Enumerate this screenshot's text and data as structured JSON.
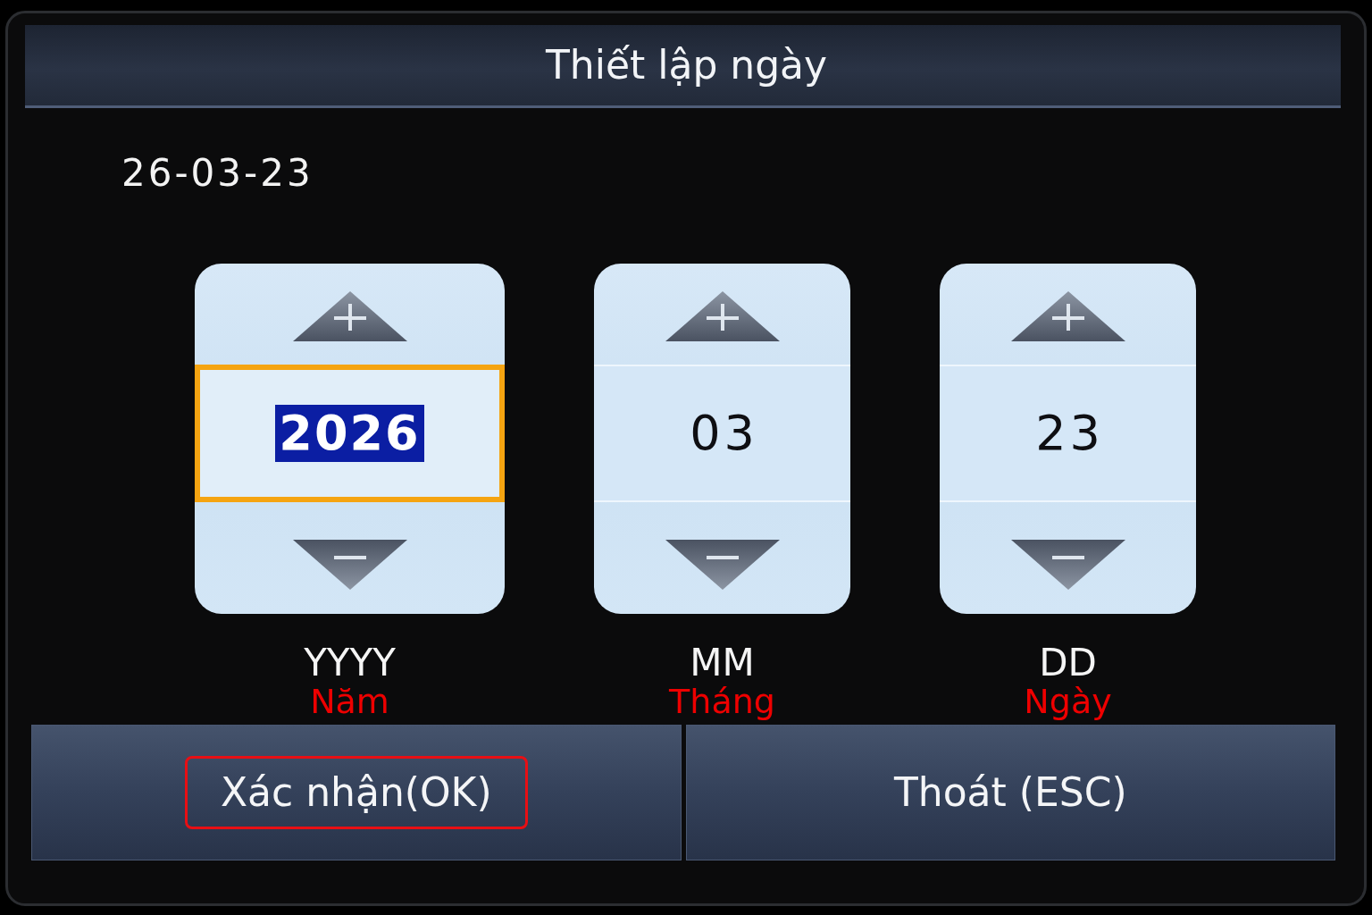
{
  "window": {
    "title": "Thiết lập ngày"
  },
  "current_date": "26-03-23",
  "spinners": [
    {
      "value": "2026",
      "label": "YYYY",
      "annotation": "Năm",
      "selected": true
    },
    {
      "value": "03",
      "label": "MM",
      "annotation": "Tháng",
      "selected": false
    },
    {
      "value": "23",
      "label": "DD",
      "annotation": "Ngày",
      "selected": false
    }
  ],
  "buttons": [
    {
      "label": "Xác nhận(OK)",
      "highlighted": true
    },
    {
      "label": "Thoát (ESC)",
      "highlighted": false
    }
  ]
}
